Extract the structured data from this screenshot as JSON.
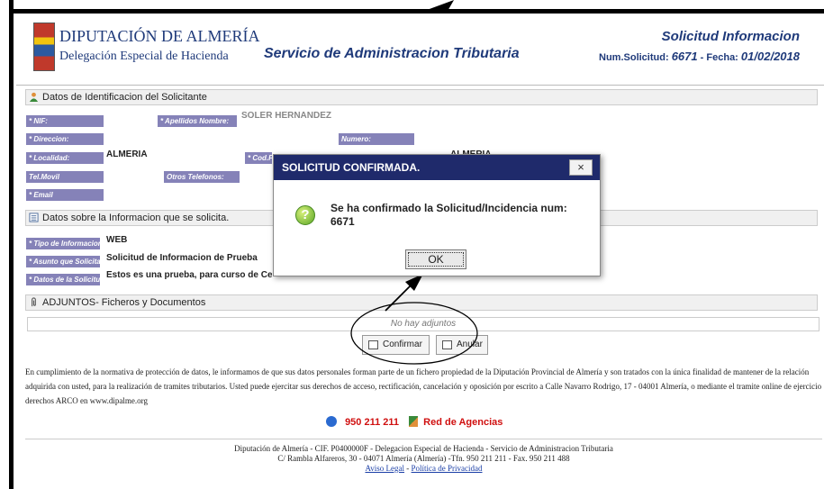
{
  "header": {
    "org_name": "DIPUTACIÓN DE ALMERÍA",
    "org_sub": "Delegación Especial de Hacienda",
    "service": "Servicio de Administracion Tributaria",
    "request_title": "Solicitud Informacion",
    "request_num_label": "Num.Solicitud:",
    "request_num": "6671",
    "date_label": "- Fecha:",
    "date": "01/02/2018"
  },
  "applicant": {
    "section_title": "Datos de Identificacion del Solicitante",
    "nif_label": "* NIF:",
    "surname_label": "* Apellidos Nombre:",
    "surname_value": "SOLER HERNANDEZ",
    "address_label": "* Direccion:",
    "number_label": "Numero:",
    "locality_label": "* Localidad:",
    "locality_value": "ALMERIA",
    "postal_label": "* Cod.Postal:",
    "province_value": "ALMERIA",
    "mobile_label": "Tel.Movil",
    "other_phones_label": "Otros Telefonos:",
    "email_label": "* Email"
  },
  "info": {
    "section_title": "Datos sobre la Informacion que se solicita.",
    "type_label": "* Tipo de Informacion:",
    "type_value": "WEB",
    "subject_label": "* Asunto que Solicita:",
    "subject_value": "Solicitud de Informacion de Prueba",
    "details_label": "* Datos de la Solicitud:",
    "details_value": "Estos es una prueba, para curso de Centros Gu"
  },
  "attachments": {
    "section_title": "ADJUNTOS- Ficheros y Documentos",
    "empty_text": "No hay adjuntos"
  },
  "actions": {
    "confirm_label": "Confirmar",
    "cancel_label": "Anular"
  },
  "modal": {
    "title": "SOLICITUD CONFIRMADA.",
    "close_label": "×",
    "message_line1": "Se ha confirmado la Solicitud/Incidencia num:",
    "message_line2": "6671",
    "ok_label": "OK"
  },
  "legal_text": "En cumplimiento de la normativa de protección de datos, le informamos de que sus datos personales forman parte de un fichero propiedad de la Diputación Provincial de Almería y son tratados con la única finalidad de mantener de la relación adquirida con usted, para la realización de tramites tributarios. Usted puede ejercitar sus derechos de acceso, rectificación, cancelación y oposición por escrito a Calle Navarro Rodrigo, 17 - 04001 Almería, o mediante el tramite online de ejercicio derechos ARCO en www.dipalme.org",
  "contact": {
    "phone": "950 211 211",
    "agencies": "Red de Agencias"
  },
  "footer": {
    "line1": "Diputación de Almería - CIF. P0400000F - Delegacion Especial de Hacienda - Servicio de Administracion Tributaria",
    "line2": "C/ Rambla Alfareros, 30 - 04071 Almería (Almería) -Tfn. 950 211 211 - Fax. 950 211 488",
    "legal_link": "Aviso Legal",
    "separator": " - ",
    "privacy_link": "Política de Privacidad"
  },
  "colors": {
    "label_bg": "#8582b8",
    "modal_title_bg": "#1f2a6b",
    "brand_blue": "#1f3a7a",
    "phone_red": "#d01010"
  }
}
